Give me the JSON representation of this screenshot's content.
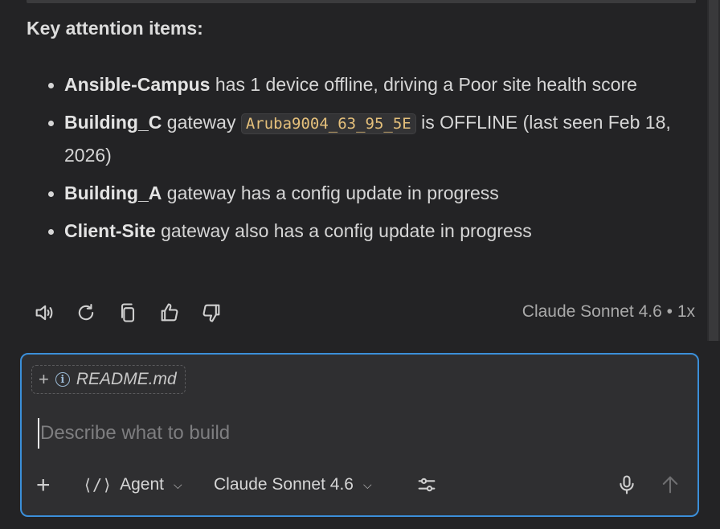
{
  "section": {
    "heading": "Key attention items:"
  },
  "items": [
    {
      "bold": "Ansible-Campus",
      "text": " has 1 device offline, driving a Poor site health score"
    },
    {
      "bold": "Building_C",
      "pre": " gateway ",
      "code": "Aruba9004_63_95_5E",
      "post": " is OFFLINE (last seen Feb 18, 2026)"
    },
    {
      "bold": "Building_A",
      "text": " gateway has a config update in progress"
    },
    {
      "bold": "Client-Site",
      "text": " gateway also has a config update in progress"
    }
  ],
  "response_meta": {
    "model": "Claude Sonnet 4.6",
    "separator": "•",
    "multiplier": "1x"
  },
  "composer": {
    "attachment": {
      "plus": "+",
      "info": "i",
      "filename": "README.md"
    },
    "placeholder": "Describe what to build",
    "add": "+",
    "mode": "Agent",
    "model": "Claude Sonnet 4.6"
  },
  "icons": {
    "actions": [
      "speaker-icon",
      "retry-icon",
      "copy-icon",
      "thumbs-up-icon",
      "thumbs-down-icon"
    ],
    "toolbar": [
      "plus-icon",
      "agent-icon",
      "chevron-down-icon",
      "settings-sliders-icon",
      "microphone-icon",
      "send-arrow-icon"
    ]
  },
  "colors": {
    "accent": "#3b8fd9",
    "code_text": "#e5c07b",
    "background": "#232325"
  }
}
